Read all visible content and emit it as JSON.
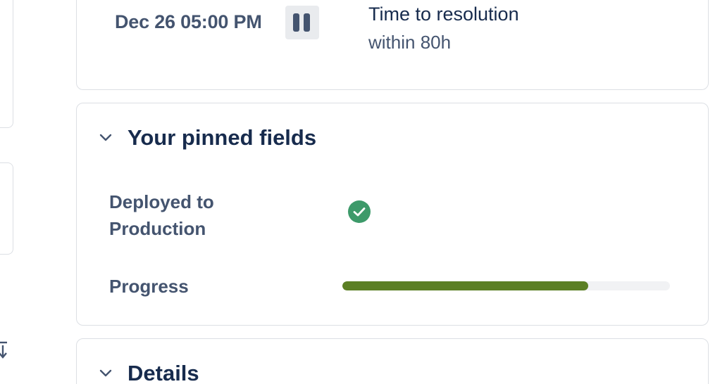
{
  "sla": {
    "date": "Dec 26 05:00 PM",
    "title": "Time to resolution",
    "subtitle": "within 80h",
    "pause_icon": "pause-icon"
  },
  "pinned": {
    "title": "Your pinned fields",
    "toggle_icon": "chevron-down-icon",
    "fields": {
      "deployed_label": "Deployed to Production",
      "deployed_status": "check-circle-icon",
      "progress_label": "Progress",
      "progress_value": 0.75
    }
  },
  "details": {
    "title": "Details",
    "toggle_icon": "chevron-down-icon"
  },
  "colors": {
    "progress_fill": "#5b7f24",
    "progress_track": "#f1f2f4",
    "check": "#3d9a6a"
  }
}
